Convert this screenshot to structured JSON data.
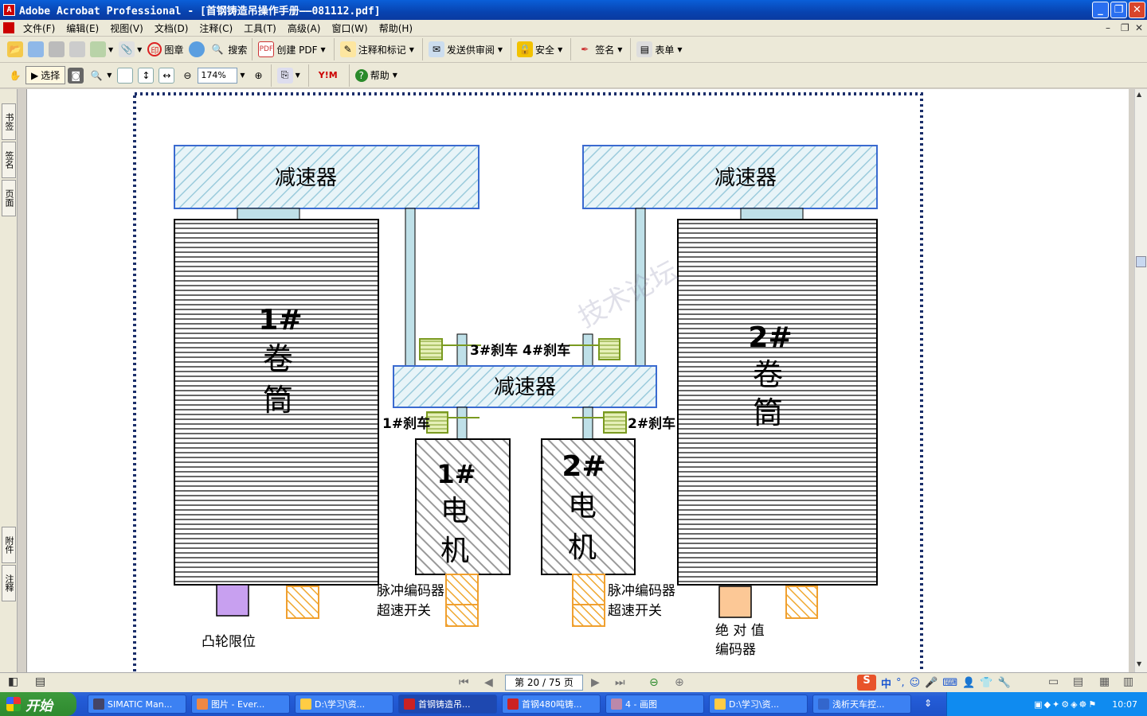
{
  "window": {
    "title": "Adobe Acrobat Professional - [首钢铸造吊操作手册——081112.pdf]"
  },
  "menu": [
    "文件(F)",
    "编辑(E)",
    "视图(V)",
    "文档(D)",
    "注释(C)",
    "工具(T)",
    "高级(A)",
    "窗口(W)",
    "帮助(H)"
  ],
  "toolbar1": {
    "stamp": "图章",
    "search": "搜索",
    "create_pdf": "创建 PDF",
    "comment": "注释和标记",
    "send_review": "发送供审阅",
    "secure": "安全",
    "sign": "签名",
    "forms": "表单"
  },
  "toolbar2": {
    "select": "选择",
    "zoom": "174%",
    "help": "帮助"
  },
  "left_tabs": [
    "书签",
    "签名",
    "页面",
    "附件",
    "注释"
  ],
  "diagram": {
    "reducer_left": "减速器",
    "reducer_right": "减速器",
    "reducer_center": "减速器",
    "drum1": [
      "1#",
      "卷",
      "筒"
    ],
    "drum2": [
      "2#",
      "卷",
      "筒"
    ],
    "motor1": [
      "1#",
      "电",
      "机"
    ],
    "motor2": [
      "2#",
      "电",
      "机"
    ],
    "brake1": "1#刹车",
    "brake2": "2#刹车",
    "brake3": "3#刹车",
    "brake4": "4#刹车",
    "encoder_left": [
      "脉冲编码器",
      "超速开关"
    ],
    "encoder_right": [
      "脉冲编码器",
      "超速开关"
    ],
    "cam_limit": "凸轮限位",
    "abs_encoder": [
      "绝 对 值",
      "编码器"
    ],
    "watermark": "技术论坛"
  },
  "status": {
    "page": "第 20 / 75 页"
  },
  "taskbar": {
    "start": "开始",
    "tasks": [
      "SIMATIC Man...",
      "图片 - Ever...",
      "D:\\学习\\资...",
      "首钢铸造吊...",
      "首钢480吨铸...",
      "4 - 画图",
      "D:\\学习\\资...",
      "浅析天车控..."
    ],
    "clock": "10:07"
  },
  "ime": "中"
}
